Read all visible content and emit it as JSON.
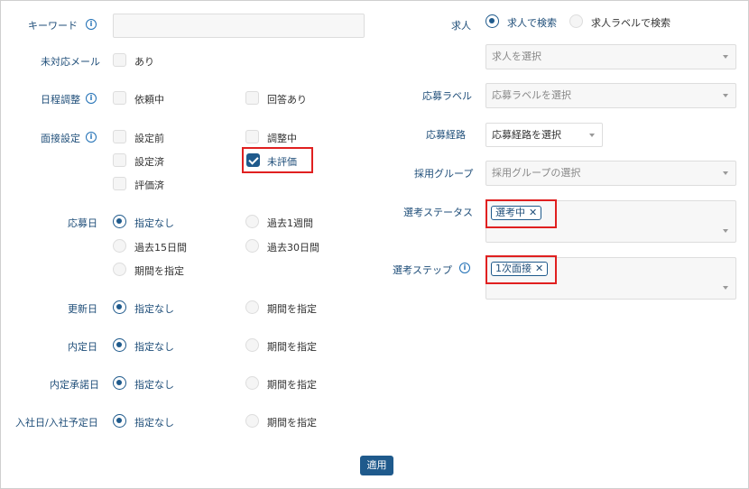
{
  "labels": {
    "keyword": "キーワード",
    "unhandled_mail": "未対応メール",
    "schedule": "日程調整",
    "interview_setting": "面接設定",
    "apply_date": "応募日",
    "update_date": "更新日",
    "offer_date": "内定日",
    "offer_accept_date": "内定承諾日",
    "join_date": "入社日/入社予定日",
    "job": "求人",
    "apply_label": "応募ラベル",
    "apply_route": "応募経路",
    "hiring_group": "採用グループ",
    "selection_status": "選考ステータス",
    "selection_step": "選考ステップ"
  },
  "options": {
    "ari": "あり",
    "requesting": "依頼中",
    "answered": "回答あり",
    "before_setting": "設定前",
    "adjusting": "調整中",
    "set_done": "設定済",
    "unrated": "未評価",
    "rated": "評価済",
    "none_specified": "指定なし",
    "past_1_week": "過去1週間",
    "past_15_days": "過去15日間",
    "past_30_days": "過去30日間",
    "specify_period": "期間を指定",
    "search_by_job": "求人で検索",
    "search_by_job_label": "求人ラベルで検索"
  },
  "selects": {
    "job": "求人を選択",
    "apply_label": "応募ラベルを選択",
    "apply_route": "応募経路を選択",
    "hiring_group": "採用グループの選択"
  },
  "tags": {
    "status": "選考中",
    "step": "1次面接"
  },
  "apply_button": "適用",
  "info_glyph": "i",
  "close_glyph": "✕"
}
